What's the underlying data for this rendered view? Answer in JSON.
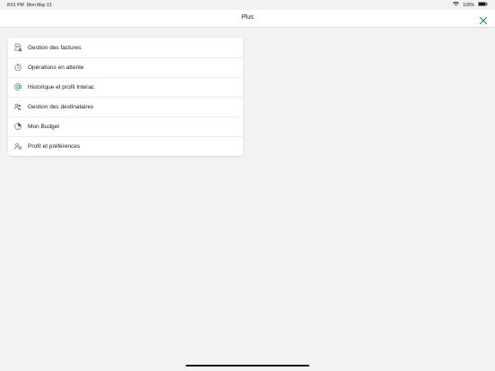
{
  "status_bar": {
    "time": "8:51 PM",
    "date": "Mon May 13",
    "battery": "100%"
  },
  "header": {
    "title": "Plus",
    "close_icon": "close-icon"
  },
  "menu": {
    "items": [
      {
        "label": "Gestion des factures",
        "icon": "bill-icon"
      },
      {
        "label": "Opérations en attente",
        "icon": "pending-icon"
      },
      {
        "label": "Historique et profil Interac",
        "icon": "at-icon"
      },
      {
        "label": "Gestion des destinataires",
        "icon": "recipients-icon"
      },
      {
        "label": "Mon Budget",
        "icon": "budget-icon"
      },
      {
        "label": "Profil et préférences",
        "icon": "profile-settings-icon"
      }
    ]
  },
  "colors": {
    "accent": "#1a8a4a",
    "background": "#f2f2f2",
    "surface": "#ffffff"
  }
}
